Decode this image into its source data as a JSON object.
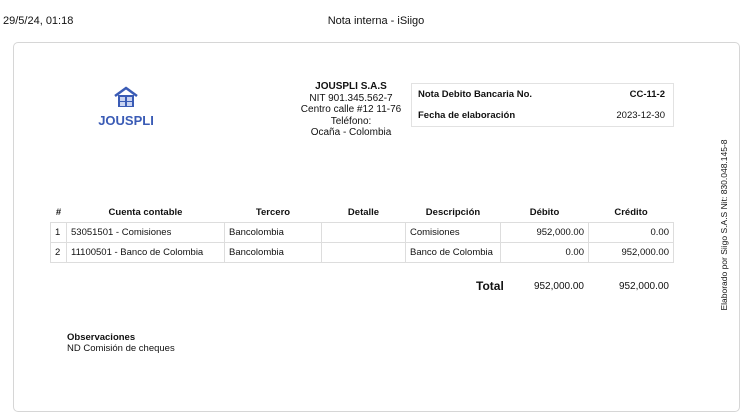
{
  "browser": {
    "date": "29/5/24, 01:18",
    "title": "Nota interna - iSiigo"
  },
  "logo": {
    "name": "JOUSPLI",
    "icon": "house-icon",
    "color": "#3a5bb5"
  },
  "company": {
    "name": "JOUSPLI S.A.S",
    "nit": "NIT 901.345.562-7",
    "address": "Centro calle #12 11-76",
    "phone": "Teléfono:",
    "city": "Ocaña - Colombia"
  },
  "doc": {
    "number_label": "Nota Debito Bancaria No.",
    "number": "CC-11-2",
    "date_label": "Fecha de elaboración",
    "date": "2023-12-30"
  },
  "table": {
    "headers": [
      "#",
      "Cuenta contable",
      "Tercero",
      "Detalle",
      "Descripción",
      "Débito",
      "Crédito"
    ],
    "rows": [
      [
        "1",
        "53051501 - Comisiones",
        "Bancolombia",
        "",
        "Comisiones",
        "952,000.00",
        "0.00"
      ],
      [
        "2",
        "11100501 - Banco de Colombia",
        "Bancolombia",
        "",
        "Banco de Colombia",
        "0.00",
        "952,000.00"
      ]
    ]
  },
  "total": {
    "label": "Total",
    "debit": "952,000.00",
    "credit": "952,000.00"
  },
  "side_text": "Elaborado por Siigo S.A.S Nit: 830.048.145-8",
  "observations": {
    "label": "Observaciones",
    "text": "ND Comisión de cheques"
  }
}
